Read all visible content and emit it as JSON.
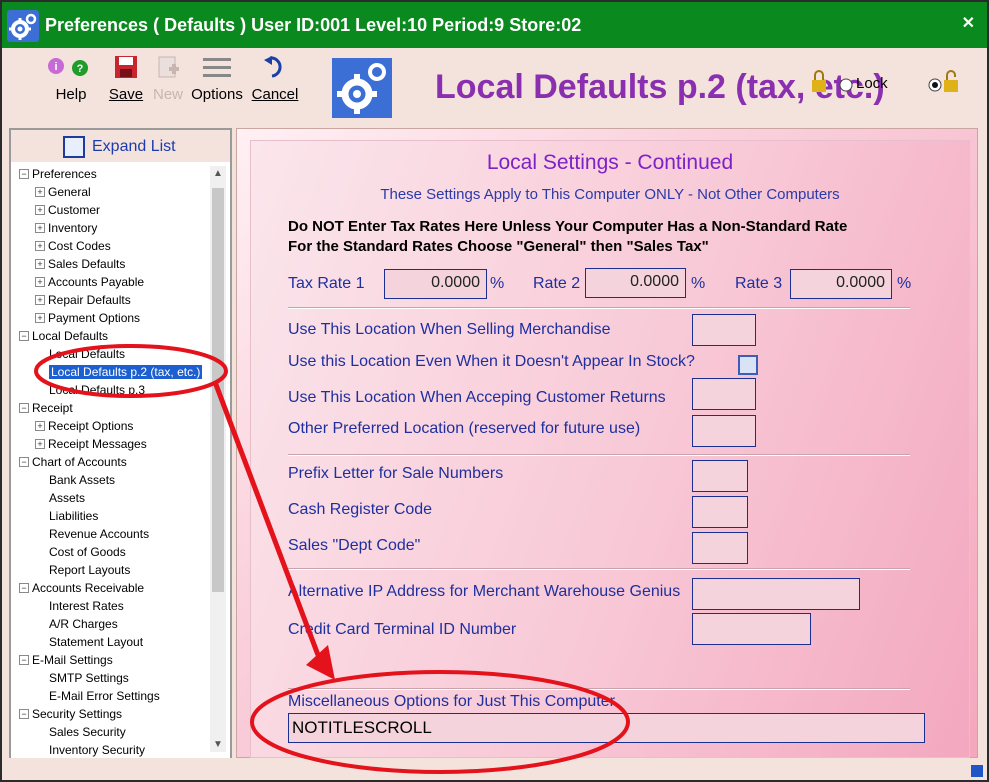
{
  "titlebar": {
    "title": "Preferences ( Defaults )    User ID:001  Level:10  Period:9  Store:02",
    "close_icon": "close-icon"
  },
  "toolbar": {
    "help": "Help",
    "save": "Save",
    "new": "New",
    "options": "Options",
    "cancel": "Cancel"
  },
  "page": {
    "title": "Local Defaults p.2 (tax, etc.)",
    "lock_label": "Lock"
  },
  "sidebar": {
    "expand_label": "Expand List",
    "tree": [
      {
        "label": "Preferences",
        "level": 0,
        "toggle": "-"
      },
      {
        "label": "General",
        "level": 1,
        "toggle": "+"
      },
      {
        "label": "Customer",
        "level": 1,
        "toggle": "+"
      },
      {
        "label": "Inventory",
        "level": 1,
        "toggle": "+"
      },
      {
        "label": "Cost Codes",
        "level": 1,
        "toggle": "+"
      },
      {
        "label": "Sales Defaults",
        "level": 1,
        "toggle": "+"
      },
      {
        "label": "Accounts Payable",
        "level": 1,
        "toggle": "+"
      },
      {
        "label": "Repair Defaults",
        "level": 1,
        "toggle": "+"
      },
      {
        "label": "Payment Options",
        "level": 1,
        "toggle": "+"
      },
      {
        "label": "Local Defaults",
        "level": 0,
        "toggle": "-"
      },
      {
        "label": "Local Defaults",
        "level": 1,
        "toggle": ""
      },
      {
        "label": "Local Defaults p.2 (tax, etc.)",
        "level": 1,
        "toggle": "",
        "selected": true
      },
      {
        "label": "Local Defaults p.3",
        "level": 1,
        "toggle": ""
      },
      {
        "label": "Receipt",
        "level": 0,
        "toggle": "-"
      },
      {
        "label": "Receipt Options",
        "level": 1,
        "toggle": "+"
      },
      {
        "label": "Receipt Messages",
        "level": 1,
        "toggle": "+"
      },
      {
        "label": "Chart of Accounts",
        "level": 0,
        "toggle": "-"
      },
      {
        "label": "Bank Assets",
        "level": 1,
        "toggle": ""
      },
      {
        "label": "Assets",
        "level": 1,
        "toggle": ""
      },
      {
        "label": "Liabilities",
        "level": 1,
        "toggle": ""
      },
      {
        "label": "Revenue Accounts",
        "level": 1,
        "toggle": ""
      },
      {
        "label": "Cost of Goods",
        "level": 1,
        "toggle": ""
      },
      {
        "label": "Report Layouts",
        "level": 1,
        "toggle": ""
      },
      {
        "label": "Accounts Receivable",
        "level": 0,
        "toggle": "-"
      },
      {
        "label": "Interest Rates",
        "level": 1,
        "toggle": ""
      },
      {
        "label": "A/R Charges",
        "level": 1,
        "toggle": ""
      },
      {
        "label": "Statement Layout",
        "level": 1,
        "toggle": ""
      },
      {
        "label": "E-Mail Settings",
        "level": 0,
        "toggle": "-"
      },
      {
        "label": "SMTP Settings",
        "level": 1,
        "toggle": ""
      },
      {
        "label": "E-Mail Error Settings",
        "level": 1,
        "toggle": ""
      },
      {
        "label": "Security Settings",
        "level": 0,
        "toggle": "-"
      },
      {
        "label": "Sales Security",
        "level": 1,
        "toggle": ""
      },
      {
        "label": "Inventory Security",
        "level": 1,
        "toggle": ""
      }
    ]
  },
  "main": {
    "heading": "Local Settings - Continued",
    "subheading": "These Settings Apply to This Computer ONLY - Not Other Computers",
    "warning_line1": "Do NOT Enter Tax Rates Here Unless Your Computer Has a Non-Standard Rate",
    "warning_line2": "For the Standard Rates Choose \"General\" then \"Sales Tax\"",
    "tax_rate1_label": "Tax Rate 1",
    "tax_rate1_value": "0.0000",
    "rate2_label": "Rate 2",
    "rate2_value": "0.0000",
    "rate3_label": "Rate 3",
    "rate3_value": "0.0000",
    "pct": "%",
    "loc_selling_label": "Use This Location When Selling Merchandise",
    "loc_even_label": "Use this Location Even When it Doesn't Appear In Stock?",
    "loc_returns_label": "Use This Location When Acceping Customer Returns",
    "loc_other_label": "Other Preferred Location (reserved for future use)",
    "prefix_label": "Prefix Letter for Sale Numbers",
    "cash_reg_label": "Cash Register Code",
    "dept_code_label": "Sales \"Dept Code\"",
    "alt_ip_label": "Alternative IP Address for Merchant Warehouse Genius",
    "cc_terminal_label": "Credit Card Terminal ID Number",
    "misc_label": "Miscellaneous Options for Just This Computer",
    "misc_value": "NOTITLESCROLL"
  },
  "annotations": {
    "color": "#e3121b"
  }
}
